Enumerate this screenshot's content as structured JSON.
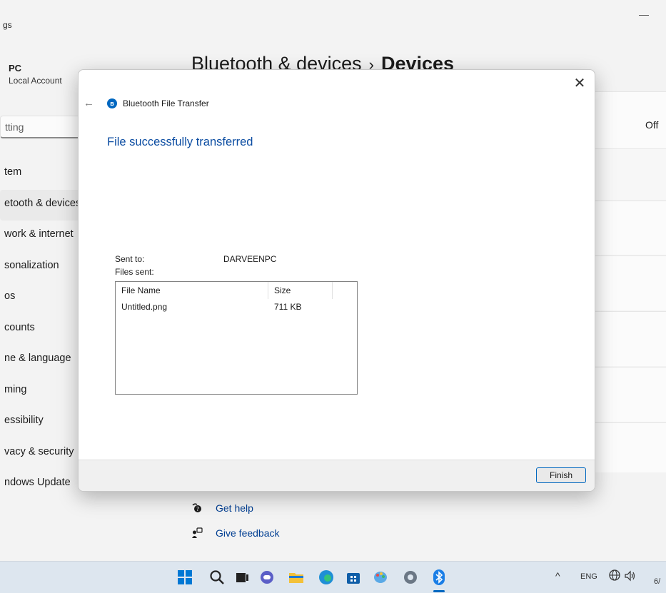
{
  "settings": {
    "app_title": "gs",
    "minimize": "—",
    "account": {
      "name": "PC",
      "type": "Local Account"
    },
    "search_placeholder": "tting",
    "nav": [
      {
        "label": "tem"
      },
      {
        "label": "etooth & devices"
      },
      {
        "label": "work & internet"
      },
      {
        "label": "sonalization"
      },
      {
        "label": "os"
      },
      {
        "label": "counts"
      },
      {
        "label": "ne & language"
      },
      {
        "label": "ming"
      },
      {
        "label": "essibility"
      },
      {
        "label": "vacy & security"
      },
      {
        "label": "ndows Update"
      }
    ],
    "breadcrumb": {
      "parent": "Bluetooth & devices",
      "separator": "›",
      "current": "Devices"
    },
    "toggle_state": "Off",
    "links": {
      "help": "Get help",
      "feedback": "Give feedback"
    }
  },
  "dialog": {
    "close": "✕",
    "back": "←",
    "title": "Bluetooth File Transfer",
    "status": "File successfully transferred",
    "sent_to_label": "Sent to:",
    "sent_to_value": "DARVEENPC",
    "files_sent_label": "Files sent:",
    "table": {
      "headers": [
        "File Name",
        "Size"
      ],
      "rows": [
        {
          "name": "Untitled.png",
          "size": "711 KB"
        }
      ]
    },
    "finish_label": "Finish"
  },
  "taskbar": {
    "apps": [
      "start-icon",
      "search-icon",
      "task-view-icon",
      "chat-icon",
      "file-explorer-icon",
      "edge-icon",
      "store-icon",
      "paint-icon",
      "settings-icon",
      "bluetooth-icon"
    ],
    "tray": {
      "chevron": "^",
      "language": "ENG",
      "date": "6/"
    }
  },
  "colors": {
    "accent": "#0067c0",
    "link": "#003e92",
    "status_heading": "#0c4da2"
  }
}
